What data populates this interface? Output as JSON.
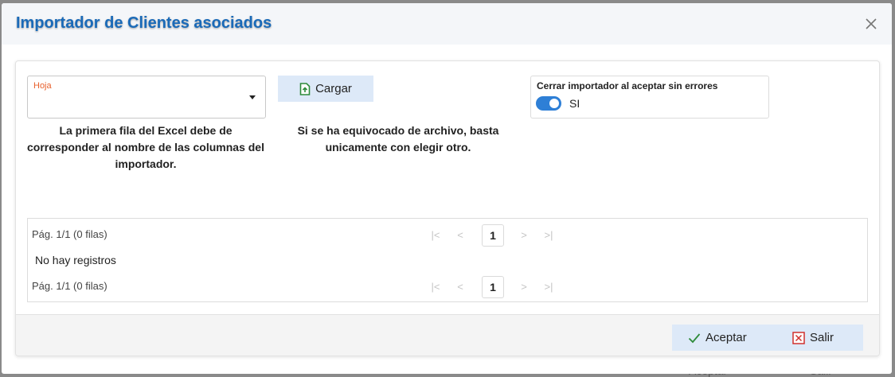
{
  "background_buttons": {
    "accept_label": "Aceptar",
    "exit_label": "Salir"
  },
  "dialog": {
    "title": "Importador de Clientes asociados",
    "close_icon": "close-icon"
  },
  "form": {
    "sheet_select": {
      "label": "Hoja",
      "value": ""
    },
    "sheet_note": "La primera fila del Excel debe de corresponder al nombre de las columnas del importador.",
    "load_button": {
      "label": "Cargar",
      "icon": "file-upload-icon"
    },
    "load_note": "Si se ha equivocado de archivo, basta unicamente con elegir otro.",
    "close_on_accept": {
      "title": "Cerrar importador al aceptar sin errores",
      "state": true,
      "state_label": "SI"
    }
  },
  "grid": {
    "page_info_top": "Pág. 1/1 (0 filas)",
    "page_info_bottom": "Pág. 1/1 (0 filas)",
    "current_page": "1",
    "pager_icons": {
      "first": "|<",
      "prev": "<",
      "next": ">",
      "last": ">|"
    },
    "empty_message": "No hay registros"
  },
  "footer": {
    "accept_label": "Aceptar",
    "accept_icon": "check-icon",
    "exit_label": "Salir",
    "exit_icon": "close-box-icon"
  },
  "colors": {
    "title": "#1a6ab8",
    "accent": "#2e7fd6",
    "button_bg": "#dde9f8",
    "field_label": "#e8602c",
    "exit_red": "#d0312d",
    "check_green": "#2e8b3a"
  }
}
